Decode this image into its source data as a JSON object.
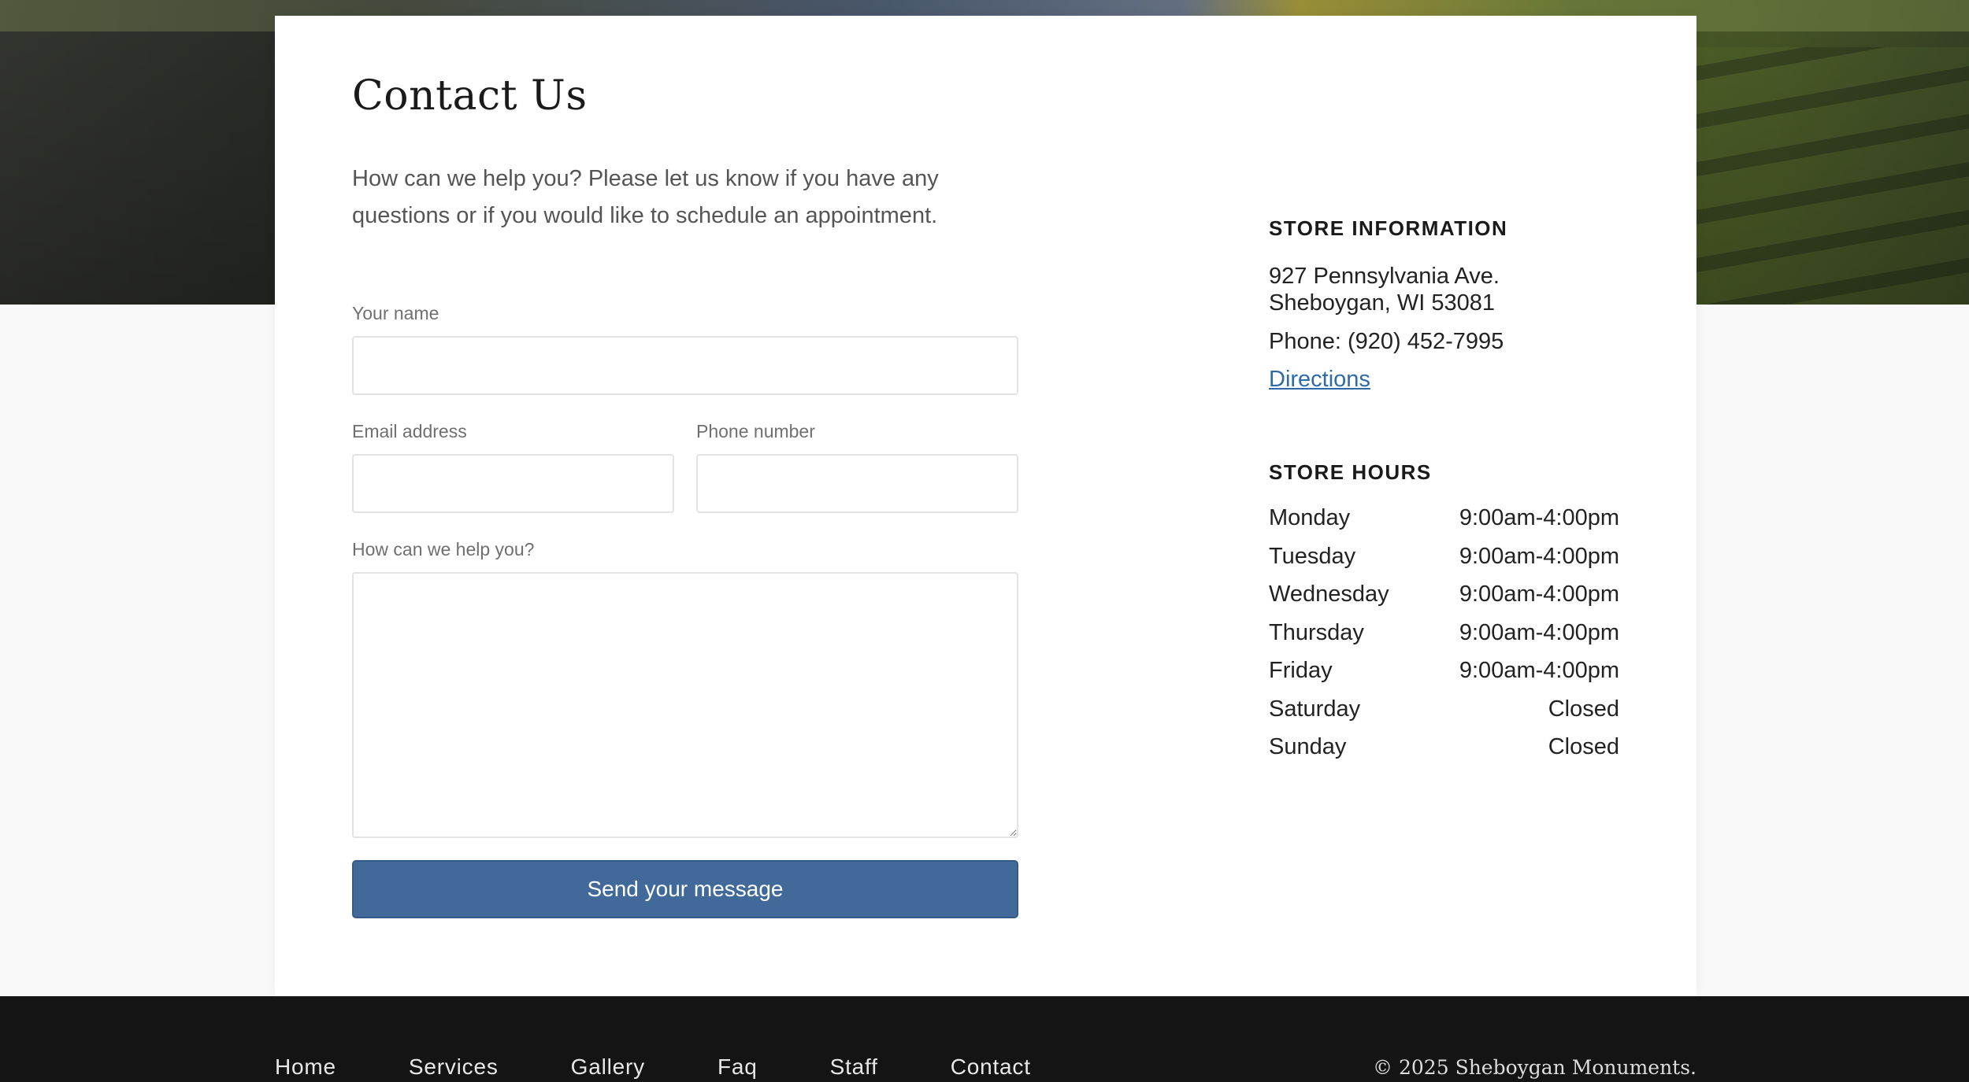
{
  "page": {
    "title": "Contact Us",
    "intro": "How can we help you? Please let us know if you have any questions or if you would like to schedule an appointment."
  },
  "form": {
    "name_label": "Your name",
    "name_value": "",
    "email_label": "Email address",
    "email_value": "",
    "phone_label": "Phone number",
    "phone_value": "",
    "message_label": "How can we help you?",
    "message_value": "",
    "submit_label": "Send your message"
  },
  "store_info": {
    "heading": "STORE INFORMATION",
    "address_line1": "927 Pennsylvania Ave.",
    "address_line2": "Sheboygan, WI 53081",
    "phone": "Phone: (920) 452-7995",
    "directions_label": "Directions"
  },
  "store_hours": {
    "heading": "STORE HOURS",
    "rows": [
      {
        "day": "Monday",
        "hours": "9:00am-4:00pm"
      },
      {
        "day": "Tuesday",
        "hours": "9:00am-4:00pm"
      },
      {
        "day": "Wednesday",
        "hours": "9:00am-4:00pm"
      },
      {
        "day": "Thursday",
        "hours": "9:00am-4:00pm"
      },
      {
        "day": "Friday",
        "hours": "9:00am-4:00pm"
      },
      {
        "day": "Saturday",
        "hours": "Closed"
      },
      {
        "day": "Sunday",
        "hours": "Closed"
      }
    ]
  },
  "footer": {
    "nav": [
      "Home",
      "Services",
      "Gallery",
      "Faq",
      "Staff",
      "Contact"
    ],
    "copyright": "© 2025 Sheboygan Monuments."
  },
  "colors": {
    "button": "#416a9a",
    "link": "#2d6aa8",
    "footer_bg": "#141414",
    "page_bg": "#f9f9f9"
  }
}
